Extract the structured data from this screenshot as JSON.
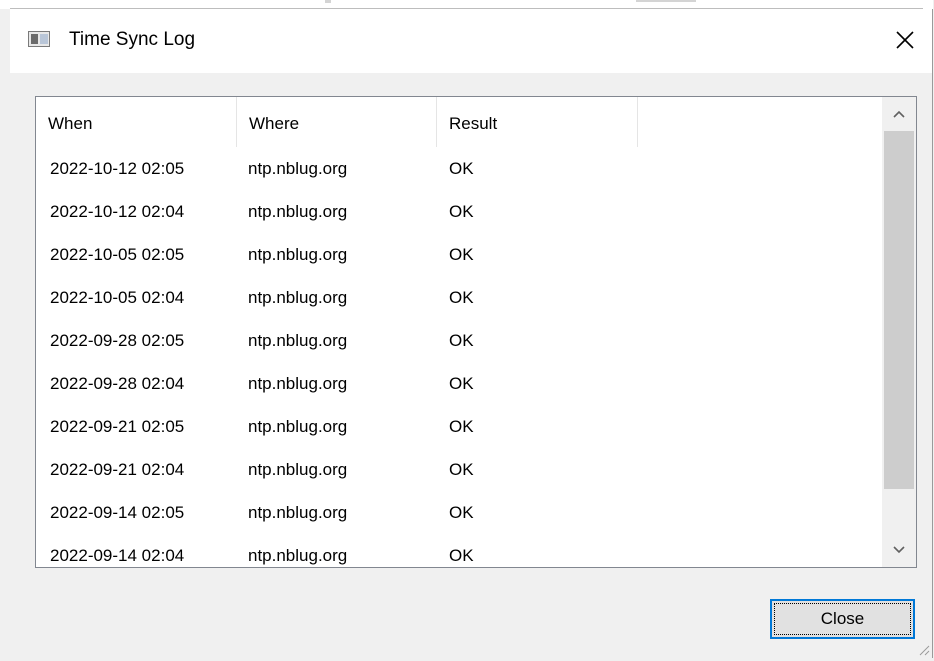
{
  "window": {
    "title": "Time Sync Log",
    "icon": "app-window-icon",
    "close_icon": "close-icon"
  },
  "table": {
    "columns": [
      "When",
      "Where",
      "Result"
    ],
    "rows": [
      {
        "when": "2022-10-12 02:05",
        "where": "ntp.nblug.org",
        "result": "OK"
      },
      {
        "when": "2022-10-12 02:04",
        "where": "ntp.nblug.org",
        "result": "OK"
      },
      {
        "when": "2022-10-05 02:05",
        "where": "ntp.nblug.org",
        "result": "OK"
      },
      {
        "when": "2022-10-05 02:04",
        "where": "ntp.nblug.org",
        "result": "OK"
      },
      {
        "when": "2022-09-28 02:05",
        "where": "ntp.nblug.org",
        "result": "OK"
      },
      {
        "when": "2022-09-28 02:04",
        "where": "ntp.nblug.org",
        "result": "OK"
      },
      {
        "when": "2022-09-21 02:05",
        "where": "ntp.nblug.org",
        "result": "OK"
      },
      {
        "when": "2022-09-21 02:04",
        "where": "ntp.nblug.org",
        "result": "OK"
      },
      {
        "when": "2022-09-14 02:05",
        "where": "ntp.nblug.org",
        "result": "OK"
      },
      {
        "when": "2022-09-14 02:04",
        "where": "ntp.nblug.org",
        "result": "OK"
      }
    ]
  },
  "buttons": {
    "close_label": "Close"
  },
  "colors": {
    "accent": "#0078d7",
    "window_bg": "#f0f0f0",
    "list_bg": "#ffffff",
    "scroll_thumb": "#cdcdcd"
  },
  "icons": {
    "scroll_up": "chevron-up-icon",
    "scroll_down": "chevron-down-icon",
    "resize_grip": "resize-grip-icon"
  }
}
